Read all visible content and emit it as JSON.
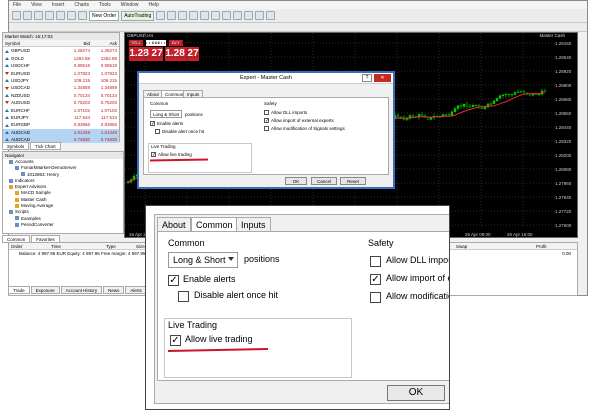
{
  "menu": [
    "File",
    "View",
    "Insert",
    "Charts",
    "Tools",
    "Window",
    "Help"
  ],
  "toolbar": {
    "new_order": "New Order",
    "autotrading": "AutoTrading"
  },
  "market_watch": {
    "title": "Market Watch: 16:17:03",
    "columns": [
      "Symbol",
      "Bid",
      "Ask"
    ],
    "rows": [
      {
        "symbol": "GBPUSD",
        "bid": "1.28274",
        "ask": "1.28274",
        "dir": "up"
      },
      {
        "symbol": "GOLD",
        "bid": "1282.88",
        "ask": "1282.88",
        "dir": "up"
      },
      {
        "symbol": "USDCHF",
        "bid": "0.99519",
        "ask": "0.99519",
        "dir": "up"
      },
      {
        "symbol": "EURUSD",
        "bid": "1.07823",
        "ask": "1.07823",
        "dir": "down"
      },
      {
        "symbol": "USDJPY",
        "bid": "109.215",
        "ask": "109.215",
        "dir": "up"
      },
      {
        "symbol": "USDCAD",
        "bid": "1.34859",
        "ask": "1.34859",
        "dir": "down"
      },
      {
        "symbol": "NZDUSD",
        "bid": "0.70134",
        "ask": "0.70134",
        "dir": "up"
      },
      {
        "symbol": "AUDUSD",
        "bid": "0.75203",
        "ask": "0.75203",
        "dir": "down"
      },
      {
        "symbol": "EURCHF",
        "bid": "1.07102",
        "ask": "1.07102",
        "dir": "up"
      },
      {
        "symbol": "EURJPY",
        "bid": "117.534",
        "ask": "117.534",
        "dir": "up"
      },
      {
        "symbol": "EURGBP",
        "bid": "0.83856",
        "ask": "0.83856",
        "dir": "up"
      },
      {
        "symbol": "AUDCAD",
        "bid": "1.01348",
        "ask": "1.01348",
        "dir": "up",
        "selected": true
      },
      {
        "symbol": "AUDCAD",
        "bid": "0.74830",
        "ask": "0.74830",
        "dir": "up",
        "selected": true
      }
    ],
    "tabs": [
      "Symbols",
      "Tick Chart"
    ]
  },
  "navigator": {
    "title": "Navigator",
    "items": [
      {
        "label": "Accounts",
        "indent": 1,
        "kind": "acc"
      },
      {
        "label": "FxmarkMarket-DemoServer",
        "indent": 2,
        "kind": "acc"
      },
      {
        "label": "1012863: Henry",
        "indent": 3,
        "kind": "acc"
      },
      {
        "label": "Indicators",
        "indent": 1,
        "kind": "ind"
      },
      {
        "label": "Expert Advisors",
        "indent": 1,
        "kind": "ea"
      },
      {
        "label": "MACD Sample",
        "indent": 2,
        "kind": "ea"
      },
      {
        "label": "Master Cash",
        "indent": 2,
        "kind": "ea"
      },
      {
        "label": "Moving Average",
        "indent": 2,
        "kind": "ea"
      },
      {
        "label": "Scripts",
        "indent": 1,
        "kind": "ind"
      },
      {
        "label": "Examples",
        "indent": 2,
        "kind": "ind"
      },
      {
        "label": "PeriodConverter",
        "indent": 2,
        "kind": "ind"
      }
    ],
    "tabs": [
      "Common",
      "Favorites"
    ]
  },
  "chart": {
    "title": "GBPUSD,H4",
    "ea_label": "Master Cash",
    "sell": "SELL",
    "buy": "BUY",
    "lot": "0.10",
    "sell_price": "1.28 27",
    "buy_price": "1.28 27",
    "prices": [
      "1.29160",
      "1.29040",
      "1.28920",
      "1.28800",
      "1.28680",
      "1.28560",
      "1.28440",
      "1.28320",
      "1.28200",
      "1.28080",
      "1.27960",
      "1.27840",
      "1.27720",
      "1.27600"
    ],
    "dates": [
      "16 Apr 2016",
      "17 Apr 2016",
      "18 Apr 2016",
      "19 Apr 2016",
      "20 Apr 08:00",
      "20 Apr 16:00",
      "21 Apr 2016",
      "22 Apr 2016",
      "25 Apr 08:00",
      "26 Apr 16:00"
    ]
  },
  "dialog": {
    "title": "Expert - Master Cash",
    "help": "?",
    "close": "✕",
    "tabs": [
      "About",
      "Common",
      "Inputs"
    ],
    "common_group": "Common",
    "positions_value": "Long & Short",
    "positions_label": "positions",
    "enable_alerts": "Enable alerts",
    "disable_alert_once": "Disable alert once hit",
    "live_group": "Live Trading",
    "allow_live": "Allow live trading",
    "safety_group": "Safety",
    "allow_dll": "Allow DLL imports",
    "allow_external": "Allow import of external experts",
    "allow_signal_mod": "Allow modification of Signals settings",
    "ok": "OK",
    "cancel": "Cancel",
    "reset": "Reset"
  },
  "zoom": {
    "tabs": [
      "About",
      "Common",
      "Inputs"
    ],
    "common_group": "Common",
    "positions_value": "Long & Short",
    "positions_label": "positions",
    "enable_alerts": "Enable alerts",
    "disable_alert_once": "Disable alert once hit",
    "live_group": "Live Trading",
    "allow_live": "Allow live trading",
    "safety_group": "Safety",
    "allow_dll": "Allow DLL imports",
    "allow_external": "Allow import of external",
    "allow_signal_mod": "Allow modification of Si",
    "ok": "OK"
  },
  "terminal": {
    "columns": [
      "Order",
      "Time",
      "Type",
      "Size",
      "Symbol",
      "Price",
      "S / L",
      "T / P",
      "Price",
      "Commission",
      "Swap",
      "Profit"
    ],
    "balance": "Balance: 4 997.95 EUR  Equity: 4 997.95  Free margin: 4 997.95",
    "profit": "0.00",
    "tabs": [
      "Trade",
      "Exposure",
      "Account History",
      "News",
      "Alerts"
    ]
  },
  "colors": {
    "chart_bg": "#000000",
    "candle": "#00cc00",
    "ma": "#e03030",
    "underline": "#d0142a",
    "title_blue": "#3c6cbf"
  }
}
